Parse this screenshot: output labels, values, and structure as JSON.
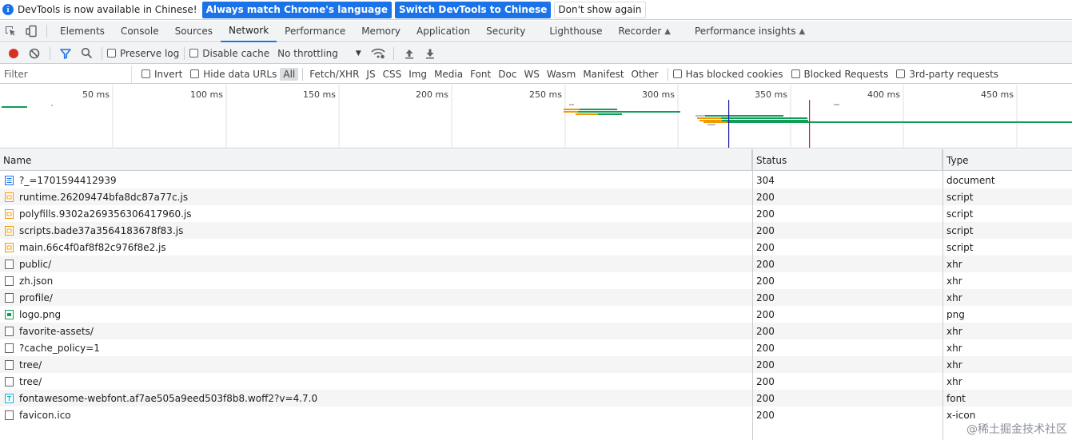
{
  "infobar": {
    "message": "DevTools is now available in Chinese!",
    "btn_match": "Always match Chrome's language",
    "btn_switch": "Switch DevTools to Chinese",
    "btn_dismiss": "Don't show again"
  },
  "tabs": [
    "Elements",
    "Console",
    "Sources",
    "Network",
    "Performance",
    "Memory",
    "Application",
    "Security",
    "Lighthouse",
    "Recorder",
    "Performance insights"
  ],
  "active_tab": "Network",
  "toolbar": {
    "preserve_log": "Preserve log",
    "disable_cache": "Disable cache",
    "throttling": "No throttling"
  },
  "filter": {
    "placeholder": "Filter",
    "invert": "Invert",
    "hide_data_urls": "Hide data URLs",
    "types": [
      "All",
      "Fetch/XHR",
      "JS",
      "CSS",
      "Img",
      "Media",
      "Font",
      "Doc",
      "WS",
      "Wasm",
      "Manifest",
      "Other"
    ],
    "active_type": "All",
    "blocked_cookies": "Has blocked cookies",
    "blocked_requests": "Blocked Requests",
    "third_party": "3rd-party requests"
  },
  "overview": {
    "ticks": [
      "50 ms",
      "100 ms",
      "150 ms",
      "200 ms",
      "250 ms",
      "300 ms",
      "350 ms",
      "400 ms",
      "450 ms"
    ]
  },
  "table": {
    "columns": {
      "name": "Name",
      "status": "Status",
      "type": "Type"
    },
    "rows": [
      {
        "name": "?_=1701594412939",
        "status": "304",
        "type": "document",
        "icon": "document-icon"
      },
      {
        "name": "runtime.26209474bfa8dc87a77c.js",
        "status": "200",
        "type": "script",
        "icon": "script-icon"
      },
      {
        "name": "polyfills.9302a269356306417960.js",
        "status": "200",
        "type": "script",
        "icon": "script-icon"
      },
      {
        "name": "scripts.bade37a3564183678f83.js",
        "status": "200",
        "type": "script",
        "icon": "script-icon"
      },
      {
        "name": "main.66c4f0af8f82c976f8e2.js",
        "status": "200",
        "type": "script",
        "icon": "script-icon"
      },
      {
        "name": "public/",
        "status": "200",
        "type": "xhr",
        "icon": "xhr-icon"
      },
      {
        "name": "zh.json",
        "status": "200",
        "type": "xhr",
        "icon": "xhr-icon"
      },
      {
        "name": "profile/",
        "status": "200",
        "type": "xhr",
        "icon": "xhr-icon"
      },
      {
        "name": "logo.png",
        "status": "200",
        "type": "png",
        "icon": "image-icon"
      },
      {
        "name": "favorite-assets/",
        "status": "200",
        "type": "xhr",
        "icon": "xhr-icon"
      },
      {
        "name": "?cache_policy=1",
        "status": "200",
        "type": "xhr",
        "icon": "xhr-icon"
      },
      {
        "name": "tree/",
        "status": "200",
        "type": "xhr",
        "icon": "xhr-icon"
      },
      {
        "name": "tree/",
        "status": "200",
        "type": "xhr",
        "icon": "xhr-icon"
      },
      {
        "name": "fontawesome-webfont.af7ae505a9eed503f8b8.woff2?v=4.7.0",
        "status": "200",
        "type": "font",
        "icon": "font-icon"
      },
      {
        "name": "favicon.ico",
        "status": "200",
        "type": "x-icon",
        "icon": "xhr-icon"
      }
    ]
  },
  "watermark": "@稀土掘金技术社区",
  "colors": {
    "accent": "#1a73e8",
    "record": "#d93025",
    "dom_content_loaded": "#1a1aa6",
    "load": "#c5221f",
    "waiting": "#f29900",
    "download": "#0f9d58"
  }
}
